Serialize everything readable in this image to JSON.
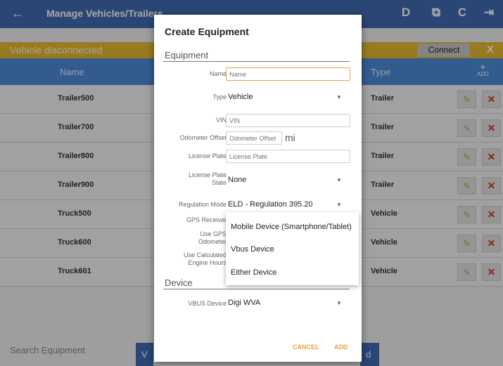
{
  "app": {
    "title": "Manage Vehicles/Trailers",
    "banner": "Vehicle disconnected",
    "connect_label": "Connect",
    "dismiss_label": "X",
    "top_icons": [
      "D",
      "⧉",
      "C",
      "⇥"
    ],
    "columns": {
      "name": "Name",
      "type": "Type",
      "add": "ADD"
    },
    "rows": [
      {
        "name": "Trailer500",
        "type": "Trailer"
      },
      {
        "name": "Trailer700",
        "type": "Trailer"
      },
      {
        "name": "Trailer800",
        "type": "Trailer"
      },
      {
        "name": "Trailer900",
        "type": "Trailer"
      },
      {
        "name": "Truck500",
        "type": "Vehicle"
      },
      {
        "name": "Truck600",
        "type": "Vehicle"
      },
      {
        "name": "Truck601",
        "type": "Vehicle"
      }
    ],
    "search_placeholder": "Search Equipment",
    "bottom_left": "V",
    "bottom_right": "d"
  },
  "dialog": {
    "title": "Create Equipment",
    "section_equipment": "Equipment",
    "section_device": "Device",
    "name_label": "Name",
    "name_placeholder": "Name",
    "type_label": "Type",
    "type_value": "Vehicle",
    "vin_label": "VIN",
    "vin_placeholder": "VIN",
    "odometer_label": "Odometer Offset",
    "odometer_placeholder": "Odometer Offset",
    "odometer_unit": "mi",
    "plate_label": "License Plate",
    "plate_placeholder": "License Plate",
    "plate_state_label_1": "License Plate",
    "plate_state_label_2": "State",
    "plate_state_value": "None",
    "regulation_label": "Regulation Mode",
    "regulation_value": "ELD - Regulation 395.20",
    "gps_label": "GPS Receiver",
    "use_gps_label_1": "Use GPS",
    "use_gps_label_2": "Odometer",
    "use_calc_label_1": "Use Calculated",
    "use_calc_label_2": "Engine Hours",
    "vbus_label": "VBUS Device",
    "vbus_value": "Digi WVA",
    "cancel_label": "CANCEL",
    "add_label": "ADD"
  },
  "gps_popup": {
    "options": [
      "Mobile Device (Smartphone/Tablet)",
      "Vbus Device",
      "Either Device"
    ]
  },
  "colors": {
    "primary": "#3f6bb0",
    "header": "#4d8bd8",
    "banner": "#e7b931",
    "accent": "#e6a33a",
    "delete": "#d23a2a"
  }
}
